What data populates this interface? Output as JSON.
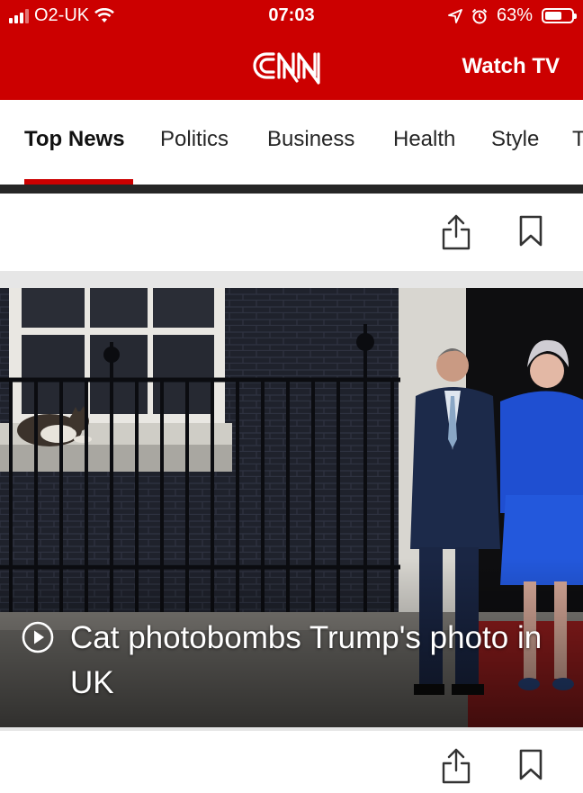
{
  "status_bar": {
    "carrier": "O2-UK",
    "time": "07:03",
    "battery_percent": "63%",
    "battery_level": 0.63,
    "icons": [
      "signal-icon",
      "wifi-icon",
      "location-icon",
      "alarm-icon",
      "battery-icon"
    ]
  },
  "header": {
    "logo_icon": "cnn-logo",
    "watch_tv": "Watch TV",
    "brand_color": "#cc0000"
  },
  "nav": {
    "tabs": [
      "Top News",
      "Politics",
      "Business",
      "Health",
      "Style",
      "T"
    ],
    "active_index": 0
  },
  "article_actions": {
    "share_icon": "share-icon",
    "bookmark_icon": "bookmark-icon"
  },
  "story": {
    "headline": "Cat photobombs Trump's photo in UK",
    "media_icon": "play-icon"
  }
}
